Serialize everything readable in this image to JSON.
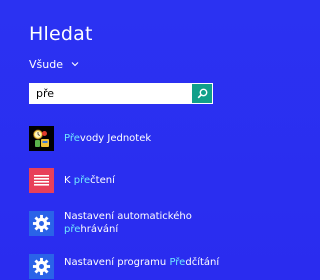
{
  "header": {
    "title": "Hledat",
    "scope": "Všude"
  },
  "search": {
    "query": "pře",
    "placeholder": ""
  },
  "results": [
    {
      "label_pre": "",
      "label_hl": "Pře",
      "label_post": "vody Jednotek",
      "label_line2": "",
      "icon": "unit-converter-icon"
    },
    {
      "label_pre": "K ",
      "label_hl": "pře",
      "label_post": "čtení",
      "label_line2": "",
      "icon": "reading-list-icon"
    },
    {
      "label_pre": "Nastavení automatického",
      "label_hl": "",
      "label_post": "",
      "label_line2_hl": "pře",
      "label_line2": "hrávání",
      "icon": "gear-icon"
    },
    {
      "label_pre": "Nastavení programu ",
      "label_hl": "Pře",
      "label_post": "dčítání",
      "label_line2": "",
      "icon": "gear-icon"
    }
  ],
  "colors": {
    "background": "#2a2ef0",
    "search_button": "#11a08a",
    "highlight": "#6fe8ff",
    "reading_tile": "#e8405a",
    "settings_tile": "#2a63e8"
  }
}
